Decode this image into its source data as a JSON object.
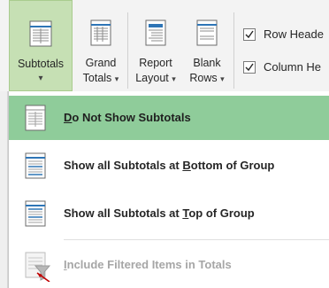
{
  "ribbon": {
    "subtotals": {
      "line1": "Subtotals",
      "caret": "▾"
    },
    "grand_totals": {
      "line1": "Grand",
      "line2": "Totals",
      "caret": "▾"
    },
    "report_layout": {
      "line1": "Report",
      "line2": "Layout",
      "caret": "▾"
    },
    "blank_rows": {
      "line1": "Blank",
      "line2": "Rows",
      "caret": "▾"
    },
    "row_headers": {
      "label": "Row Heade",
      "checked": true
    },
    "column_headers": {
      "label": "Column He",
      "checked": true
    }
  },
  "menu": {
    "items": [
      {
        "pre": "",
        "accel": "D",
        "post": "o Not Show Subtotals",
        "selected": true
      },
      {
        "pre": "Show all Subtotals at ",
        "accel": "B",
        "post": "ottom of Group"
      },
      {
        "pre": "Show all Subtotals at ",
        "accel": "T",
        "post": "op of Group"
      },
      {
        "pre": "",
        "accel": "I",
        "post": "nclude Filtered Items in Totals",
        "disabled": true
      }
    ]
  },
  "colors": {
    "selected_button": "#c6e0b4",
    "selected_menu_item": "#8fcc9a",
    "disabled_text": "#a6a6a6"
  }
}
